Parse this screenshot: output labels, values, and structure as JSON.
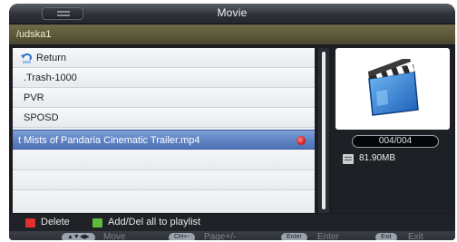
{
  "title": "Movie",
  "path": "/udska1",
  "file_list": [
    {
      "label": "Return",
      "type": "return"
    },
    {
      "label": ".Trash-1000",
      "type": "folder"
    },
    {
      "label": "PVR",
      "type": "folder"
    },
    {
      "label": "SPOSD",
      "type": "folder"
    },
    {
      "label": "t Mists of Pandaria Cinematic Trailer.mp4",
      "type": "file",
      "selected": true,
      "marked": true
    }
  ],
  "preview": {
    "icon": "clapperboard-icon",
    "counter": "004/004",
    "size_icon": "file-info-icon",
    "size": "81.90MB"
  },
  "hints": {
    "delete": {
      "label": "Delete",
      "color": "#e03030"
    },
    "playlist": {
      "label": "Add/Del all to playlist",
      "color": "#5dbb3c"
    }
  },
  "keys": {
    "move_key": "▲▼◀▶",
    "move_label": "Move",
    "page_key": "CH+-",
    "page_label": "Page+/-",
    "enter_key": "Enter",
    "enter_label": "Enter",
    "exit_key": "Exit",
    "exit_label": "Exit"
  },
  "colors": {
    "selection": "#5d80c2",
    "path_bar": "#5a5636",
    "background": "#1b1d22"
  }
}
